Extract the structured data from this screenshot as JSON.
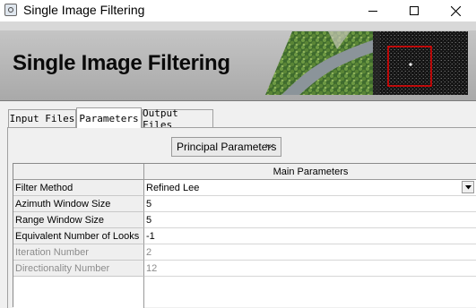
{
  "window": {
    "title": "Single Image Filtering"
  },
  "banner": {
    "title": "Single Image Filtering"
  },
  "tabs": [
    {
      "label": "Input Files",
      "active": false
    },
    {
      "label": "Parameters",
      "active": true
    },
    {
      "label": "Output Files",
      "active": false
    }
  ],
  "section_selector": {
    "value": "Principal Parameters"
  },
  "grid": {
    "header": "Main Parameters",
    "rows": [
      {
        "label": "Filter Method",
        "value": "Refined Lee",
        "enabled": true,
        "type": "dropdown"
      },
      {
        "label": "Azimuth Window Size",
        "value": "5",
        "enabled": true,
        "type": "text"
      },
      {
        "label": "Range Window Size",
        "value": "5",
        "enabled": true,
        "type": "text"
      },
      {
        "label": "Equivalent Number of Looks",
        "value": "-1",
        "enabled": true,
        "type": "text"
      },
      {
        "label": "Iteration Number",
        "value": "2",
        "enabled": false,
        "type": "text"
      },
      {
        "label": "Directionality Number",
        "value": "12",
        "enabled": false,
        "type": "text"
      }
    ]
  },
  "colors": {
    "highlight_box": "#ff0000",
    "banner_bg": "#b4b4b4"
  }
}
